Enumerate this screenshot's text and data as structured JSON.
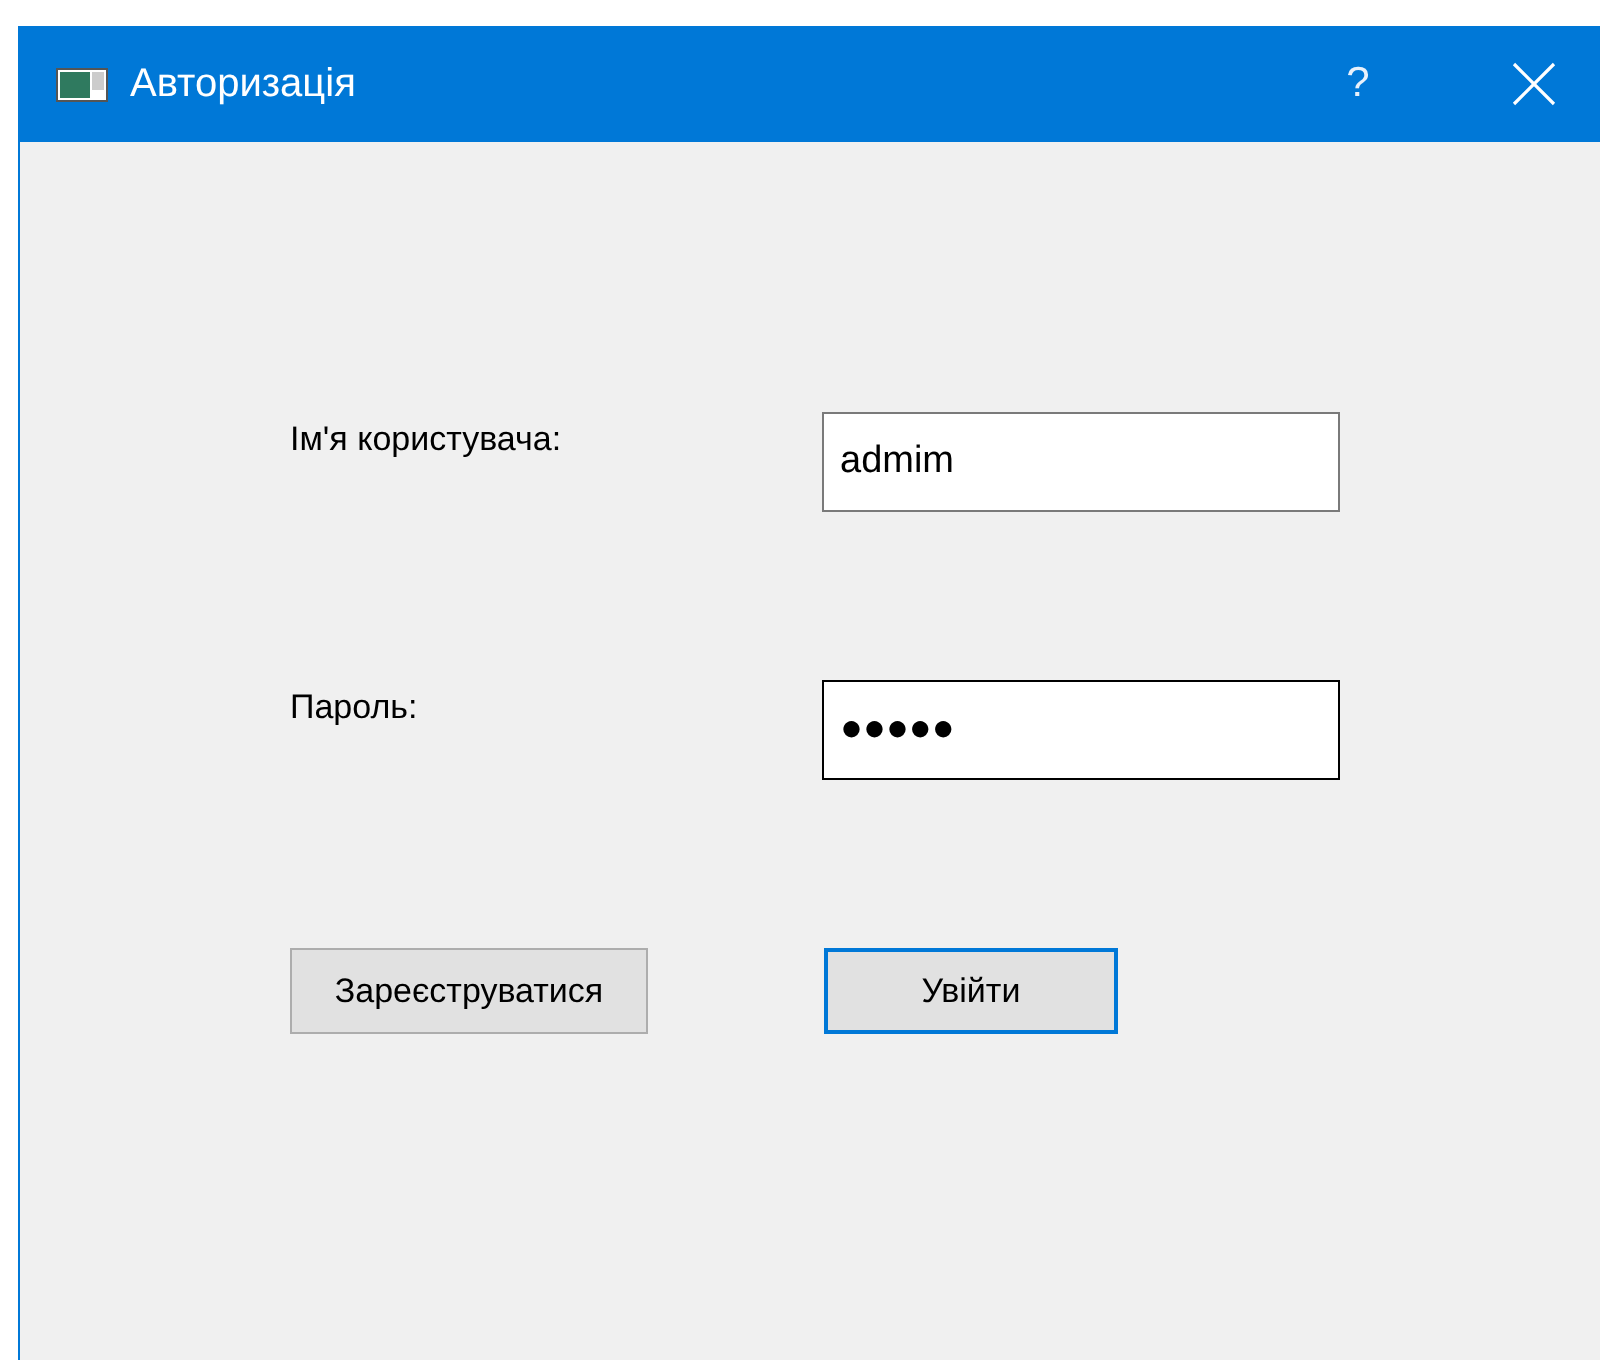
{
  "window": {
    "title": "Авторизація",
    "help_button": "?"
  },
  "fields": [
    {
      "label": "Ім'я користувача:",
      "value": "admim",
      "focused": false
    },
    {
      "label": "Пароль:",
      "value": "●●●●●",
      "focused": true
    }
  ],
  "buttons": [
    {
      "label": "Зареєструватися",
      "default": false
    },
    {
      "label": "Увійти",
      "default": true
    }
  ]
}
